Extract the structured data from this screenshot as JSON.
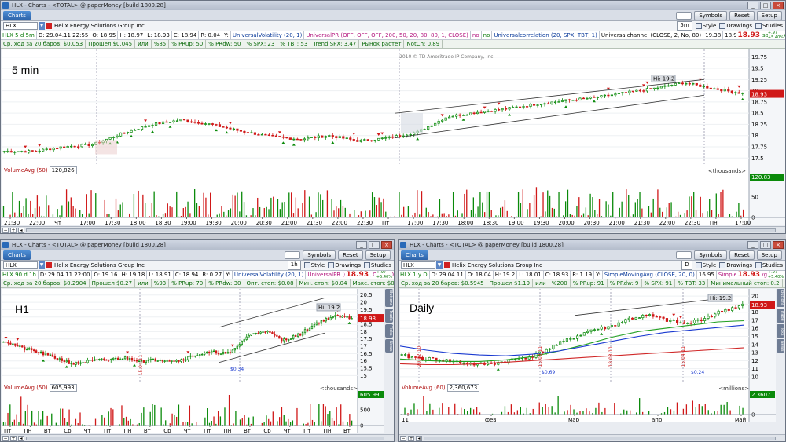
{
  "windows": [
    {
      "id": "w5m",
      "title": "HLX - Charts - <TOTAL> @ paperMoney [build 1800.28]",
      "tab": "Charts",
      "buttons": {
        "symbols": "Symbols",
        "reset": "Reset",
        "setup": "Setup"
      },
      "symbol": "HLX",
      "company": "Helix Energy Solutions Group Inc",
      "aggregation": "5m",
      "tools": {
        "style": "Style",
        "drawings": "Drawings",
        "studies": "Studies"
      },
      "study_cells": [
        {
          "t": "HLX 5 d 5m",
          "c": "grn"
        },
        {
          "t": "D: 29.04.11 22:55",
          "c": "blk"
        },
        {
          "t": "O: 18.95",
          "c": "blk"
        },
        {
          "t": "H: 18.97",
          "c": "blk"
        },
        {
          "t": "L: 18.93",
          "c": "blk"
        },
        {
          "t": "C: 18.94",
          "c": "blk"
        },
        {
          "t": "R: 0.04",
          "c": "blk"
        },
        {
          "t": "Y:",
          "c": "blk"
        },
        {
          "t": "UniversalVolatility (20, 1)",
          "c": ""
        },
        {
          "t": "UniversalPR (OFF, OFF, OFF, 200, 50, 20, 80, 80, 1, CLOSE)",
          "c": "pinkbox"
        },
        {
          "t": "no",
          "c": "pinkbox"
        },
        {
          "t": "no",
          "c": "grn"
        },
        {
          "t": "Universalcorrelation (20, SPX, TBT, 1)",
          "c": ""
        },
        {
          "t": "Universalchannel (CLOSE, 2, No, 80)",
          "c": "blk"
        },
        {
          "t": "19.38",
          "c": "blk"
        },
        {
          "t": "18.97",
          "c": "blk"
        },
        {
          "t": "UniversalRange (20, 1.5, OFF, OFF, O...",
          "c": "grn"
        }
      ],
      "last_price": "18.93",
      "change_top": "+.97",
      "change_bottom": "+5.40%",
      "info_cells": [
        "Ср. ход за 20 баров: $0.053",
        "Прошел $0.045",
        "или",
        "%85",
        "% PRup: 50",
        "% PRdw: 50",
        "% SPX: 23",
        "% TBT: 53",
        "Trend SPX: 3.47",
        "Рынок растет",
        "NotCh: 0.89"
      ],
      "copyright": "2010 © TD Ameritrade IP Company, Inc.",
      "tf_label": "5 min",
      "hi_label": "Hi: 19.2",
      "price_label": "18.93",
      "vol_title": "VolumeAvg (50)",
      "vol_value": "120,826",
      "vol_units": "<thousands>",
      "vol_label": "120.83",
      "price_ticks": [
        "19.75",
        "19.5",
        "19.25",
        "19",
        "18.75",
        "18.5",
        "18.25",
        "18",
        "17.75",
        "17.5"
      ],
      "vol_ticks": [
        "100",
        "50",
        "0"
      ],
      "time_ticks": [
        "21:30",
        "22:00",
        "Чт",
        "17:00",
        "17:30",
        "18:00",
        "18:30",
        "19:00",
        "19:30",
        "20:00",
        "20:30",
        "21:00",
        "21:30",
        "22:00",
        "22:30",
        "Пт",
        "17:00",
        "17:30",
        "18:00",
        "18:30",
        "19:00",
        "19:30",
        "20:00",
        "20:30",
        "21:00",
        "21:30",
        "22:00",
        "22:30",
        "Пн",
        "17:00"
      ],
      "side_buttons": []
    },
    {
      "id": "wh1",
      "title": "HLX - Charts - <TOTAL> @ paperMoney [build 1800.28]",
      "tab": "Charts",
      "buttons": {
        "symbols": "Symbols",
        "reset": "Reset",
        "setup": "Setup"
      },
      "symbol": "HLX",
      "company": "Helix Energy Solutions Group Inc",
      "aggregation": "1h",
      "tools": {
        "style": "Style",
        "drawings": "Drawings",
        "studies": "Studies"
      },
      "study_cells": [
        {
          "t": "HLX 90 d 1h",
          "c": "grn"
        },
        {
          "t": "D: 29.04.11 22:00",
          "c": "blk"
        },
        {
          "t": "O: 19.16",
          "c": "blk"
        },
        {
          "t": "H: 19.18",
          "c": "blk"
        },
        {
          "t": "L: 18.91",
          "c": "blk"
        },
        {
          "t": "C: 18.94",
          "c": "blk"
        },
        {
          "t": "R: 0.27",
          "c": "blk"
        },
        {
          "t": "Y:",
          "c": "blk"
        },
        {
          "t": "UniversalVolatility (20, 1)",
          "c": ""
        },
        {
          "t": "UniversalPR (OFF, OFF, OFF, 20...",
          "c": "pinkbox"
        }
      ],
      "last_price": "18.93",
      "change_top": "+.97",
      "change_bottom": "+5.40%",
      "info_cells": [
        "Ср. ход за 20 баров: $0.2904",
        "Прошел $0.27",
        "или",
        "%93",
        "% PRup: 70",
        "% PRdw: 30",
        "Опт. стоп: $0.08",
        "Мин. стоп: $0.04",
        "Макс. стоп: $0.16"
      ],
      "tf_label": "H1",
      "hi_label": "Hi: 19.2",
      "price_label": "18.93",
      "lo_label": "$0.34",
      "vertical_date": "15.04.11",
      "vol_title": "VolumeAvg (50)",
      "vol_value": "605,993",
      "vol_units": "<thousands>",
      "vol_label": "605.99",
      "price_ticks": [
        "20.5",
        "20",
        "19.5",
        "19",
        "18.5",
        "18",
        "17.5",
        "17",
        "16.5",
        "16",
        "15.5",
        "15"
      ],
      "vol_ticks": [
        "1,000",
        "500",
        "0"
      ],
      "time_ticks": [
        "Пт",
        "Пн",
        "Вт",
        "Ср",
        "Чт",
        "Пт",
        "Пн",
        "Вт",
        "Ср",
        "Чт",
        "Пт",
        "Пн",
        "Вт",
        "Ср",
        "Чт",
        "Пт",
        "Пн",
        "Вт"
      ],
      "side_buttons": [
        "Buttons",
        "Trade",
        "Ticks",
        "News"
      ]
    },
    {
      "id": "wd",
      "title": "HLX - Charts - <TOTAL> @ paperMoney [build 1800.28]",
      "tab": "Charts",
      "buttons": {
        "symbols": "Symbols",
        "reset": "Reset",
        "setup": "Setup"
      },
      "symbol": "HLX",
      "company": "Helix Energy Solutions Group Inc",
      "aggregation": "D",
      "tools": {
        "style": "Style",
        "drawings": "Drawings",
        "studies": "Studies"
      },
      "study_cells": [
        {
          "t": "HLX 1 y D",
          "c": "grn"
        },
        {
          "t": "D: 29.04.11",
          "c": "blk"
        },
        {
          "t": "O: 18.04",
          "c": "blk"
        },
        {
          "t": "H: 19.2",
          "c": "blk"
        },
        {
          "t": "L: 18.01",
          "c": "blk"
        },
        {
          "t": "C: 18.93",
          "c": "blk"
        },
        {
          "t": "R: 1.19",
          "c": "blk"
        },
        {
          "t": "Y:",
          "c": "blk"
        },
        {
          "t": "SimpleMovingAvg (CLOSE, 20, 0)",
          "c": ""
        },
        {
          "t": "16.95",
          "c": "blk"
        },
        {
          "t": "SimpleMovingAvg (CLO...",
          "c": "pinkbox"
        }
      ],
      "last_price": "18.93",
      "change_top": "+.97",
      "change_bottom": "+5.40%",
      "info_cells": [
        "Ср. ход за 20 баров: $0.5945",
        "Прошел $1.19",
        "или",
        "%200",
        "% PRup: 91",
        "% PRdw: 9",
        "% SPX: 91",
        "% TBT: 33",
        "Минимальный стоп: 0.2"
      ],
      "tf_label": "Daily",
      "hi_label": "Hi: 19.2",
      "price_label": "18.93",
      "lo_label_1": "$0.69",
      "lo_label_2": "$0.24",
      "vertical_dates": [
        "20.12.10",
        "15.03.11",
        "18.03.11",
        "15.04.11"
      ],
      "vol_title": "VolumeAvg (60)",
      "vol_value": "2,360,673",
      "vol_units": "<millions>",
      "vol_label": "2.3607",
      "price_ticks": [
        "20",
        "19",
        "18",
        "17",
        "16",
        "15",
        "14",
        "13",
        "12",
        "11",
        "10"
      ],
      "vol_ticks": [
        "5",
        "0"
      ],
      "time_ticks": [
        "11",
        "фев",
        "мар",
        "апр",
        "май"
      ],
      "side_buttons": [
        "Buttons",
        "Trade",
        "Ticks",
        "News"
      ]
    }
  ],
  "colors": {
    "up": "#0a8a0a",
    "down": "#d01818",
    "channel": "#333333",
    "sma_green": "#20a020",
    "sma_blue": "#1a3ad0",
    "sma_red": "#d02828",
    "hi_box": "#d8dbe0"
  }
}
